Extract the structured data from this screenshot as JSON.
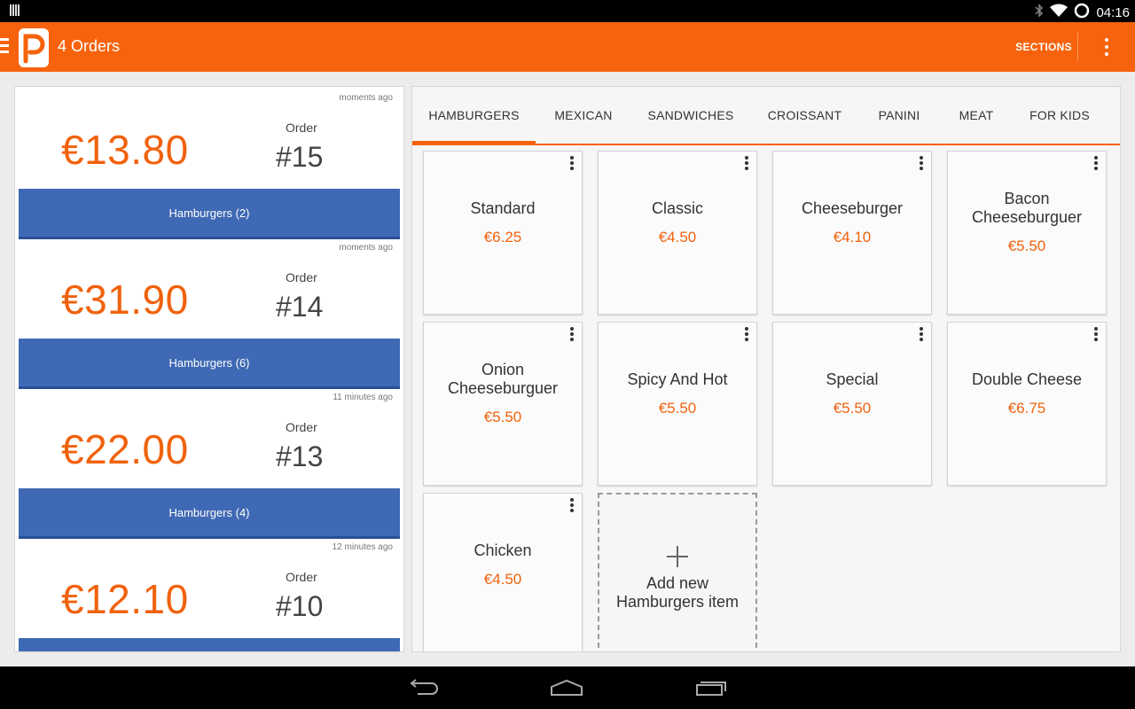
{
  "status_bar": {
    "time": "04:16",
    "icons": [
      "barcode-icon",
      "bluetooth-icon",
      "wifi-icon",
      "battery-icon"
    ]
  },
  "action_bar": {
    "logo": "app-logo",
    "title": "4 Orders",
    "sections_label": "SECTIONS",
    "overflow": "overflow-menu-icon",
    "color": "#f7630c"
  },
  "orders": [
    {
      "time": "moments ago",
      "amount": "€13.80",
      "label": "Order",
      "number": "#15",
      "summary": "Hamburgers (2)"
    },
    {
      "time": "moments ago",
      "amount": "€31.90",
      "label": "Order",
      "number": "#14",
      "summary": "Hamburgers (6)"
    },
    {
      "time": "11 minutes ago",
      "amount": "€22.00",
      "label": "Order",
      "number": "#13",
      "summary": "Hamburgers (4)"
    },
    {
      "time": "12 minutes ago",
      "amount": "€12.10",
      "label": "Order",
      "number": "#10",
      "summary": ""
    }
  ],
  "tabs": [
    {
      "label": "HAMBURGERS",
      "active": true
    },
    {
      "label": "MEXICAN",
      "active": false
    },
    {
      "label": "SANDWICHES",
      "active": false
    },
    {
      "label": "CROISSANT",
      "active": false
    },
    {
      "label": "PANINI",
      "active": false
    },
    {
      "label": "MEAT",
      "active": false
    },
    {
      "label": "FOR KIDS",
      "active": false
    }
  ],
  "menu_items": [
    {
      "name": "Standard",
      "price": "€6.25"
    },
    {
      "name": "Classic",
      "price": "€4.50"
    },
    {
      "name": "Cheeseburger",
      "price": "€4.10"
    },
    {
      "name": "Bacon Cheeseburguer",
      "price": "€5.50"
    },
    {
      "name": "Onion Cheeseburguer",
      "price": "€5.50"
    },
    {
      "name": "Spicy And Hot",
      "price": "€5.50"
    },
    {
      "name": "Special",
      "price": "€5.50"
    },
    {
      "name": "Double Cheese",
      "price": "€6.75"
    },
    {
      "name": "Chicken",
      "price": "€4.50"
    }
  ],
  "add_item": {
    "label": "Add new Hamburgers item"
  },
  "nav_bar": {
    "buttons": [
      "back-icon",
      "home-icon",
      "recents-icon"
    ]
  },
  "colors": {
    "accent": "#f7630c",
    "order_bar": "#3f69b4",
    "price": "#f0620c"
  }
}
